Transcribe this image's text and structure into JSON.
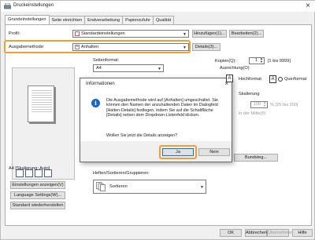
{
  "window": {
    "title": "Druckeinstellungen"
  },
  "tabs": [
    {
      "label": "Grundeinstellungen"
    },
    {
      "label": "Seite einrichten"
    },
    {
      "label": "Endverarbeitung"
    },
    {
      "label": "Papierzufuhr"
    },
    {
      "label": "Qualität"
    }
  ],
  "profile": {
    "label": "Profil:",
    "value": "Standardeinstellungen",
    "add_button": "Hinzufügen(1)...",
    "edit_button": "Bearbeiten(2)..."
  },
  "output_method": {
    "label": "Ausgabemethode:",
    "value": "Anhalten",
    "details_button": "Details(3)..."
  },
  "page_format": {
    "label": "Seitenformat:",
    "value": "A4"
  },
  "copies": {
    "label": "Kopien(Q):",
    "value": "1",
    "range": "[1 bis 9999]"
  },
  "orientation": {
    "label": "Ausrichtung(O)",
    "portrait": "Hochformat",
    "landscape": "Querformat",
    "portrait_glyph": "A",
    "landscape_glyph": "A"
  },
  "scaling": {
    "label": "Skalierung",
    "value": "100",
    "range": "% [25 bis 200]",
    "center": "in der Mitte(5)"
  },
  "booklet_button": "Bundsteg...",
  "preview": {
    "caption": "A4 [Skalierung: Auto]"
  },
  "left_buttons": {
    "show_settings": "Einstellungen anzeigen(V)",
    "language": "Language Settings(W)...",
    "restore_default": "Standard wiederherstellen"
  },
  "finishing": {
    "label": "Heften/Sortieren/Gruppieren:",
    "value": "Sortieren"
  },
  "footer": {
    "ok": "OK",
    "cancel": "Abbrechen",
    "apply": "Übernehmen",
    "help": "Hilfe"
  },
  "dialog": {
    "title": "Informationen",
    "message": "Die Ausgabemethode wird auf [Anhalten] umgeschaltet. Sie können den Namen der anzuhaltenden Daten im Dialogfeld [Halten-Details] festlegen, indem Sie auf die Schaltfläche [Details] neben dem Dropdown-Listenfeld klicken.",
    "question": "Wollen Sie jetzt die Details anzeigen?",
    "yes": "Ja",
    "no": "Nein",
    "info_glyph": "i"
  },
  "colors": {
    "highlight": "#f0a030",
    "accent": "#0078d7",
    "info_icon": "#1a66c8"
  }
}
